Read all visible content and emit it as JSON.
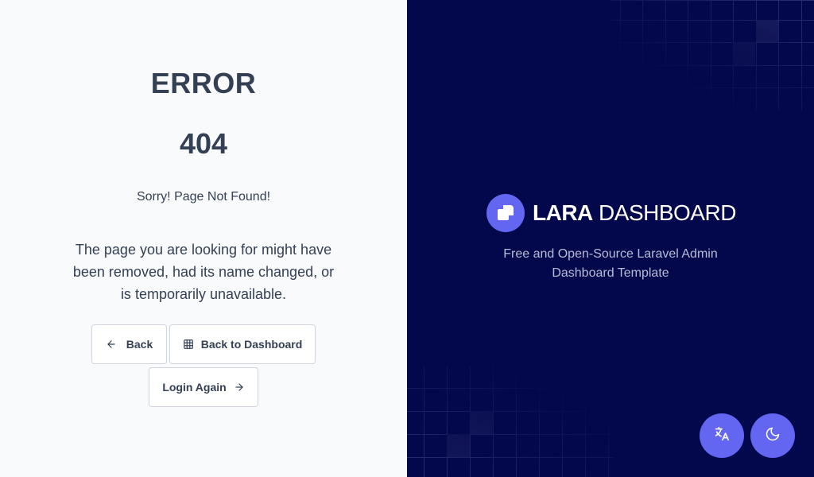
{
  "error": {
    "title": "ERROR",
    "code": "404",
    "subtitle": "Sorry! Page Not Found!",
    "description": "The page you are looking for might have been removed, had its name changed, or is temporarily unavailable."
  },
  "buttons": {
    "back": {
      "label": "Back",
      "icon": "arrow-left-icon"
    },
    "dashboard": {
      "label": "Back to Dashboard",
      "icon": "grid-icon"
    },
    "login": {
      "label": "Login Again",
      "icon": "arrow-right-icon"
    }
  },
  "brand": {
    "name_bold": "LARA",
    "name_light": "DASHBOARD",
    "tagline": "Free and Open-Source Laravel Admin Dashboard Template",
    "logo_icon": "lara-logo-icon"
  },
  "floating_buttons": {
    "language_icon": "translate-icon",
    "theme_icon": "moon-icon"
  },
  "colors": {
    "left_bg": "#f8fafc",
    "right_bg": "#03074c",
    "accent": "#6366f1",
    "text": "#344054"
  }
}
